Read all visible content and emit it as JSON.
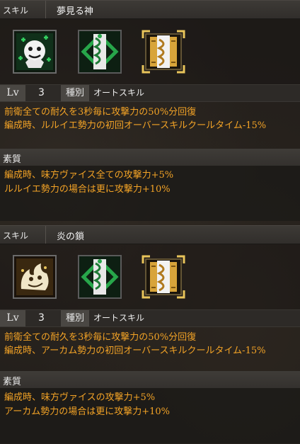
{
  "panels": [
    {
      "skill_label": "スキル",
      "skill_name": "夢見る神",
      "icons": [
        "healing-monster-icon",
        "green-sword-icon",
        "gold-sword-icon"
      ],
      "lv_label": "Lv",
      "lv_value": "3",
      "type_label": "種別",
      "type_value": "オートスキル",
      "desc_lines": [
        "前衛全ての耐久を3秒毎に攻撃力の50%分回復",
        "編成時、ルルイエ勢力の初回オーバースキルクールタイム-15%"
      ],
      "trait_label": "素質",
      "trait_lines": [
        "編成時、味方ヴァイス全ての攻撃力+5%",
        "ルルイエ勢力の場合は更に攻撃力+10%"
      ]
    },
    {
      "skill_label": "スキル",
      "skill_name": "炎の鎖",
      "icons": [
        "flame-monster-icon",
        "green-sword-icon",
        "gold-sword-icon"
      ],
      "lv_label": "Lv",
      "lv_value": "3",
      "type_label": "種別",
      "type_value": "オートスキル",
      "desc_lines": [
        "前衛全ての耐久を3秒毎に攻撃力の50%分回復",
        "編成時、アーカム勢力の初回オーバースキルクールタイム-15%"
      ],
      "trait_label": "素質",
      "trait_lines": [
        "編成時、味方ヴァイスの攻撃力+5%",
        "アーカム勢力の場合は更に攻撃力+10%"
      ]
    }
  ]
}
